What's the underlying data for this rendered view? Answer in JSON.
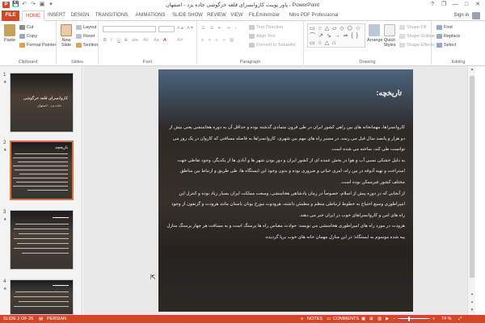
{
  "window": {
    "title": "پاور پوینت کاروانسرای قلعه خرگوشی جاده یزد - اصفهان - PowerPoint",
    "app_icon": "P",
    "qat_icons": [
      "save-icon",
      "undo-icon",
      "redo-icon",
      "start-from-beginning-icon",
      "customize-icon"
    ],
    "controls": {
      "help": "?",
      "restore": "❐",
      "minimize": "—",
      "maximize": "□",
      "close": "✕"
    }
  },
  "tabs": {
    "file": "FILE",
    "items": [
      "HOME",
      "INSERT",
      "DESIGN",
      "TRANSITIONS",
      "ANIMATIONS",
      "SLIDE SHOW",
      "REVIEW",
      "VIEW",
      "FILEminimizer",
      "Nitro PDF Professional"
    ],
    "active": "HOME",
    "sign_in": "Sign in"
  },
  "ribbon": {
    "clipboard": {
      "paste": "Paste",
      "cut": "Cut",
      "copy": "Copy",
      "format_painter": "Format Painter",
      "label": "Clipboard"
    },
    "slides": {
      "new_slide": "New Slide",
      "layout": "Layout",
      "reset": "Reset",
      "section": "Section",
      "label": "Slides"
    },
    "font": {
      "label": "Font",
      "bold": "B",
      "italic": "I",
      "underline": "U",
      "strike": "S",
      "shadow": "abc",
      "spacing": "AV",
      "case": "Aa",
      "color": "A",
      "grow": "A▲",
      "shrink": "A▼",
      "clear": "A✕"
    },
    "paragraph": {
      "label": "Paragraph",
      "text_direction": "Text Direction",
      "align_text": "Align Text",
      "smartart": "Convert to SmartArt"
    },
    "drawing": {
      "label": "Drawing",
      "shapes_preview": "▭ ○ △ ▱ ◇ ⬠ ☆ ⌒ ↗ ↘ → ⇒ { } ▭ ○ △ ⌂",
      "arrange": "Arrange",
      "quick_styles": "Quick Styles",
      "shape_fill": "Shape Fill",
      "shape_outline": "Shape Outline",
      "shape_effects": "Shape Effects"
    },
    "editing": {
      "label": "Editing",
      "find": "Find",
      "replace": "Replace",
      "select": "Select"
    }
  },
  "thumbnails": [
    {
      "number": "1",
      "title": "کاروانسرای قلعه خرگوشی",
      "subtitle": "جاده یزد - اصفهان",
      "selected": false
    },
    {
      "number": "2",
      "title": "تاریخچه",
      "subtitle": "",
      "selected": true
    },
    {
      "number": "3",
      "title": "",
      "subtitle": "",
      "selected": false
    },
    {
      "number": "4",
      "title": "",
      "subtitle": "",
      "selected": false
    }
  ],
  "slide": {
    "title": "تاریخچه:",
    "paragraphs": [
      "کاروانسراها، مهمانخانه های بین راهی کشور ایران در طی قرون متمادی گذشته بوده و حداقل آن به دوره هخامنشی یعنی بیش از دو هزار و پانصد سال قبل می رسد. در مسیر راه های مهم بین شهری، کاروانسراها به فاصله مسافتی که کاروان در یک روز می توانست طی کند، ساخته می شده است.",
      "به دلیل خشکی نسبی آب و هوا در بخش عمده ای از کشور ایران و دور بودن شهر ها و آبادی ها از یکدیگر، وجود نقاطی جهت استراحت و تهیه آذوقه در بین راه، امری حیاتی و ضروری بوده و بدون وجود این ایستگاه ها، طی طریق و ارتباط بین مناطق مختلف کشور غیرممکن بوده است.",
      "از آنجایی که در دوره پیش از اسلام، خصوصاً در زمان پادشاهی هخامنشی، وسعت مملکت ایران بسیار زیاد بوده و کنترل این امپراطوری وسیع احتیاج به خطوط ارتباطی منظم و مطمئن داشته، هرودوت مورخ یونان باستان مانند هرودت و گزنفون از وجود راه های امن و کاروانسراهای خوب در ایران خبر می دهند.",
      "هرودت در مورد راه های امپراطوری هخامنشی می نویسد: حوادث مقیاس راه ها پرسنگ است و به مسافت هر چهار پرسنگ منازل پیه شده موسوم به ایستگاه؛ در این منازل مهمان خانه های خوب برپا گردیده."
    ]
  },
  "statusbar": {
    "slide_info": "SLIDE 2 OF 26",
    "language": "PERSIAN",
    "notes": "NOTES",
    "comments": "COMMENTS",
    "zoom": "74 %",
    "zoom_level_percent": 74
  }
}
